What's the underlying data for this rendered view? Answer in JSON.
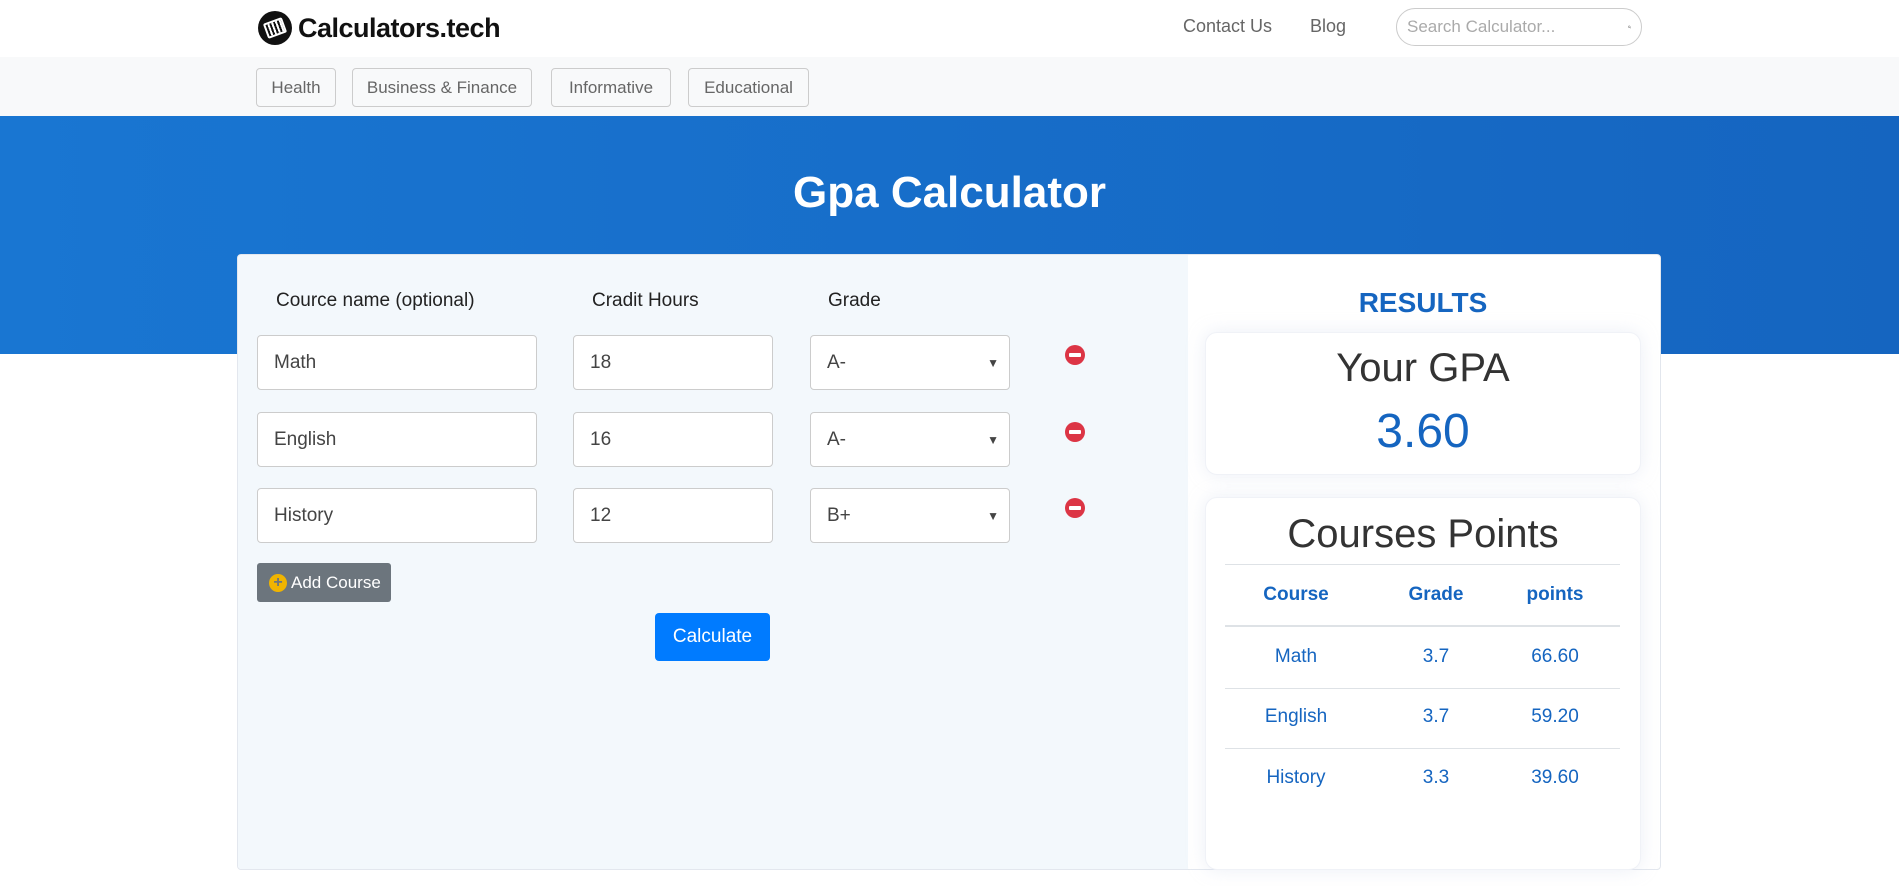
{
  "header": {
    "logo_text": "Calculators.tech",
    "links": [
      "Contact Us",
      "Blog"
    ],
    "search_placeholder": "Search Calculator..."
  },
  "nav": {
    "categories": [
      "Health",
      "Business & Finance",
      "Informative",
      "Educational"
    ]
  },
  "page": {
    "title": "Gpa Calculator"
  },
  "form": {
    "labels": {
      "course": "Cource name (optional)",
      "credit": "Cradit Hours",
      "grade": "Grade"
    },
    "rows": [
      {
        "course": "Math",
        "credit": "18",
        "grade": "A-"
      },
      {
        "course": "English",
        "credit": "16",
        "grade": "A-"
      },
      {
        "course": "History",
        "credit": "12",
        "grade": "B+"
      }
    ],
    "add_label": "Add Course",
    "calculate_label": "Calculate"
  },
  "results": {
    "title": "RESULTS",
    "gpa_label": "Your GPA",
    "gpa_value": "3.60",
    "points_title": "Courses Points",
    "columns": [
      "Course",
      "Grade",
      "points"
    ],
    "rows": [
      [
        "Math",
        "3.7",
        "66.60"
      ],
      [
        "English",
        "3.7",
        "59.20"
      ],
      [
        "History",
        "3.3",
        "39.60"
      ]
    ]
  },
  "colors": {
    "banner": "#1976d2",
    "accent": "#1565c0",
    "calculate": "#007bff",
    "remove": "#dc3545",
    "add": "#6c757d"
  }
}
